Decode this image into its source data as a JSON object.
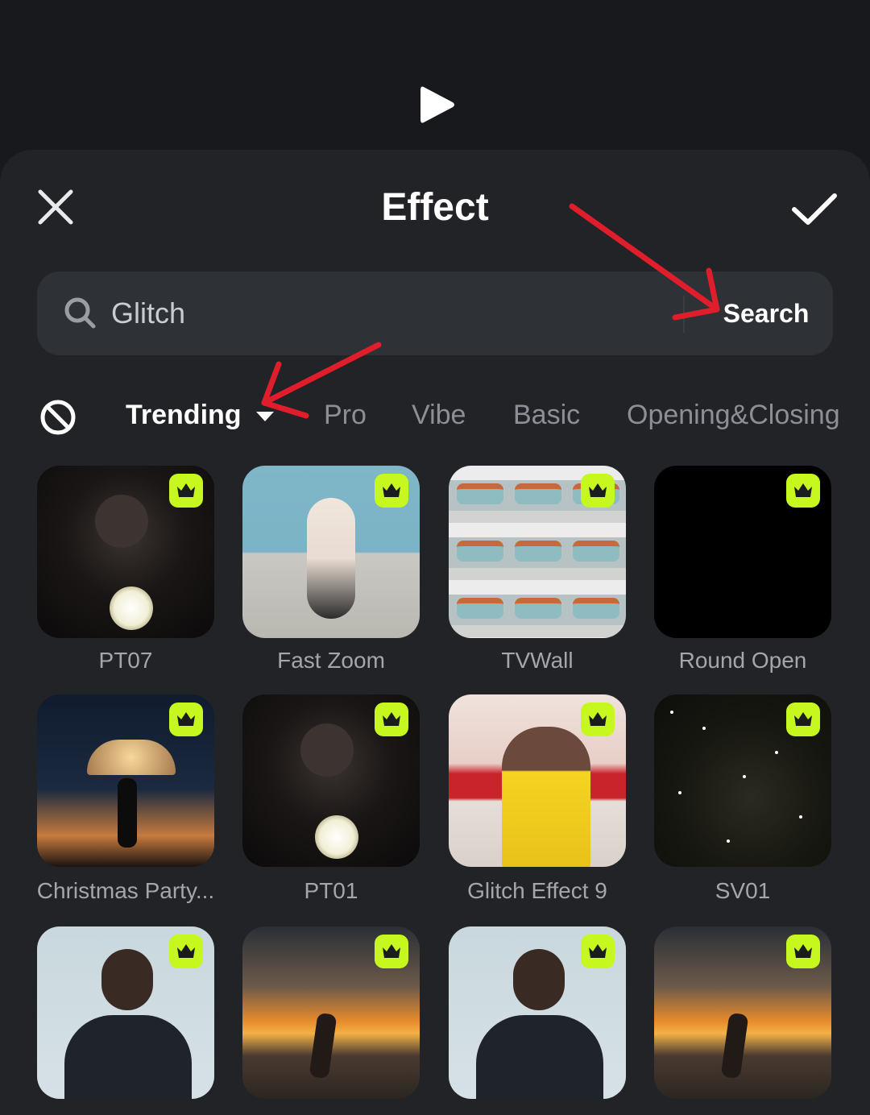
{
  "header": {
    "title": "Effect",
    "play_icon": "play-icon",
    "close_icon": "close-icon",
    "confirm_icon": "checkmark-icon"
  },
  "search": {
    "value": "Glitch",
    "placeholder": "Search",
    "button_label": "Search",
    "icon": "search-icon"
  },
  "categories": {
    "none_icon": "no-effect-icon",
    "tabs": [
      {
        "label": "Trending",
        "active": true,
        "has_dropdown": true
      },
      {
        "label": "Pro",
        "active": false
      },
      {
        "label": "Vibe",
        "active": false
      },
      {
        "label": "Basic",
        "active": false
      },
      {
        "label": "Opening&Closing",
        "active": false
      }
    ]
  },
  "effects": [
    {
      "label": "PT07",
      "premium": true
    },
    {
      "label": "Fast Zoom",
      "premium": true
    },
    {
      "label": "TVWall",
      "premium": true
    },
    {
      "label": "Round Open",
      "premium": true
    },
    {
      "label": "Christmas Party...",
      "premium": true
    },
    {
      "label": "PT01",
      "premium": true
    },
    {
      "label": "Glitch Effect 9",
      "premium": true
    },
    {
      "label": "SV01",
      "premium": true
    },
    {
      "label": "",
      "premium": true
    },
    {
      "label": "",
      "premium": true
    },
    {
      "label": "",
      "premium": true
    },
    {
      "label": "",
      "premium": true
    }
  ],
  "colors": {
    "background": "#17191d",
    "sheet": "#212327",
    "search_bg": "#2e3136",
    "premium_badge": "#c6f71f",
    "annotation_arrow": "#e01e2b",
    "inactive_tab": "#8c8f95"
  }
}
